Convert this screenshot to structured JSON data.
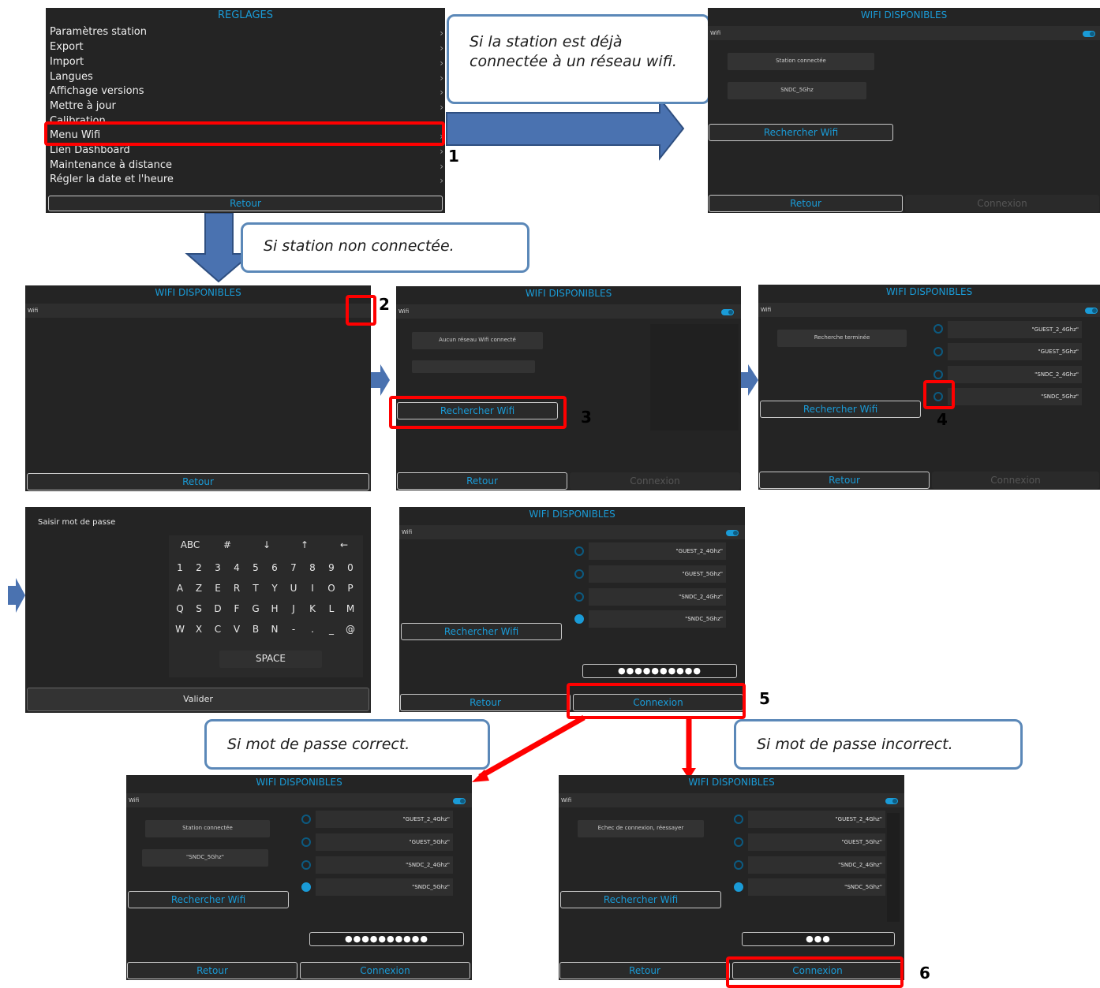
{
  "callouts": {
    "already_connected": "Si la station est déjà connectée à un réseau wifi.",
    "not_connected": "Si station non connectée.",
    "password_correct": "Si mot de passe correct.",
    "password_incorrect": "Si mot de passe incorrect."
  },
  "steps": [
    "1",
    "2",
    "3",
    "4",
    "5",
    "6"
  ],
  "settings_screen": {
    "title": "REGLAGES",
    "items": [
      "Paramètres station",
      "Export",
      "Import",
      "Langues",
      "Affichage versions",
      "Mettre à jour",
      "Calibration",
      "Menu Wifi",
      "Lien Dashboard",
      "Maintenance à distance",
      "Régler la date et l'heure"
    ],
    "back": "Retour"
  },
  "wifi": {
    "title": "WIFI DISPONIBLES",
    "wifi_label": "Wifi",
    "search_button": "Rechercher Wifi",
    "back": "Retour",
    "connect": "Connexion",
    "status_connected": "Station connectée",
    "connected_network": "SNDC_5Ghz",
    "connected_network_quoted": "\"SNDC_5Ghz\"",
    "status_none": "Aucun réseau Wifi connecté",
    "status_search_done": "Recherche terminée",
    "status_failed": "Echec de connexion, réessayer",
    "networks": [
      "\"GUEST_2_4Ghz\"",
      "\"GUEST_5Ghz\"",
      "\"SNDC_2_4Ghz\"",
      "\"SNDC_5Ghz\""
    ],
    "password_masked_long": "●●●●●●●●●●",
    "password_masked_short": "●●●"
  },
  "keyboard": {
    "prompt": "Saisir mot de passe",
    "row0": [
      "ABC",
      "#",
      "↓",
      "↑",
      "←"
    ],
    "row1": [
      "1",
      "2",
      "3",
      "4",
      "5",
      "6",
      "7",
      "8",
      "9",
      "0"
    ],
    "row2": [
      "A",
      "Z",
      "E",
      "R",
      "T",
      "Y",
      "U",
      "I",
      "O",
      "P"
    ],
    "row3": [
      "Q",
      "S",
      "D",
      "F",
      "G",
      "H",
      "J",
      "K",
      "L",
      "M"
    ],
    "row4": [
      "W",
      "X",
      "C",
      "V",
      "B",
      "N",
      "-",
      ".",
      "_",
      "@"
    ],
    "space": "SPACE",
    "validate": "Valider"
  },
  "colors": {
    "accent": "#1a9bd7",
    "screen_bg": "#242424",
    "highlight": "#ff0000",
    "arrow": "#4a72b0",
    "callout_border": "#5b88b8"
  }
}
